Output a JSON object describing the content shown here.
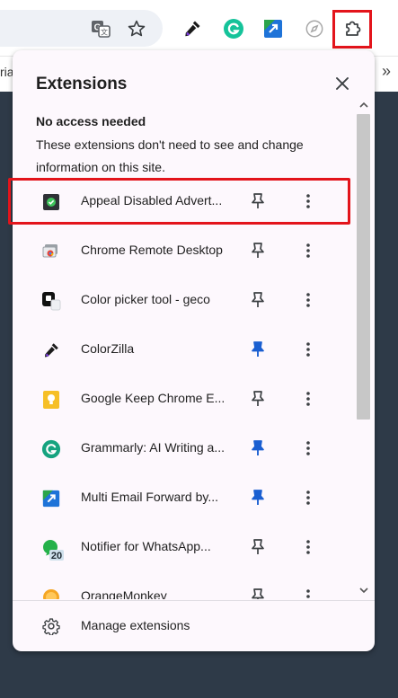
{
  "toolbar": {
    "icons": [
      "translate-icon",
      "bookmark-star-icon",
      "colorzilla-eyedropper-icon",
      "grammarly-icon",
      "multi-email-forward-icon",
      "appeal-disabled-icon",
      "extensions-puzzle-icon"
    ]
  },
  "bookmarks_bar": {
    "partial_text": "ria",
    "more_label": "»"
  },
  "popup": {
    "title": "Extensions",
    "close_label": "×",
    "section": {
      "title": "No access needed",
      "description": "These extensions don't need to see and change information on this site."
    },
    "extensions": [
      {
        "name": "Appeal Disabled Advert...",
        "pinned": false,
        "icon": "appeal-disabled-icon",
        "highlighted": true
      },
      {
        "name": "Chrome Remote Desktop",
        "pinned": false,
        "icon": "chrome-remote-desktop-icon"
      },
      {
        "name": "Color picker tool - geco",
        "pinned": false,
        "icon": "color-picker-geco-icon"
      },
      {
        "name": "ColorZilla",
        "pinned": true,
        "icon": "colorzilla-eyedropper-icon"
      },
      {
        "name": "Google Keep Chrome E...",
        "pinned": false,
        "icon": "google-keep-icon"
      },
      {
        "name": "Grammarly: AI Writing a...",
        "pinned": true,
        "icon": "grammarly-icon"
      },
      {
        "name": "Multi Email Forward by...",
        "pinned": true,
        "icon": "multi-email-forward-icon"
      },
      {
        "name": "Notifier for WhatsApp...",
        "pinned": false,
        "icon": "whatsapp-notifier-icon",
        "badge": "20"
      },
      {
        "name": "OrangeMonkey",
        "pinned": false,
        "icon": "orangemonkey-icon"
      }
    ],
    "footer": {
      "manage_label": "Manage extensions"
    }
  },
  "colors": {
    "highlight": "#e3141b",
    "pin_active": "#1a5fd1",
    "popup_bg": "#fdf8fd",
    "page_bg": "#2e3a48"
  }
}
